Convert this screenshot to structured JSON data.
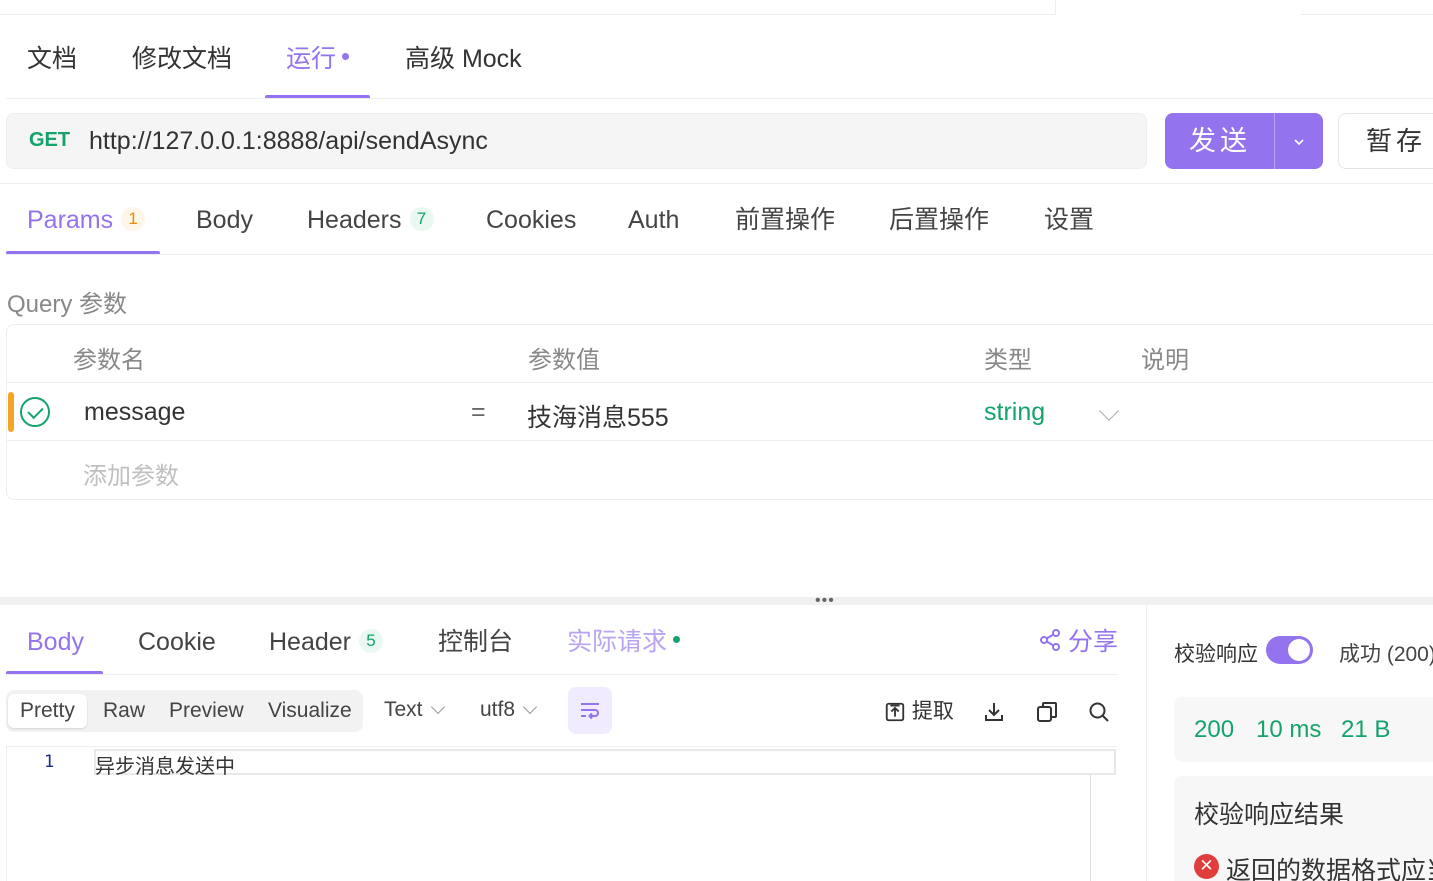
{
  "top_tabs": [
    {
      "label": "文档"
    },
    {
      "label": "修改文档"
    },
    {
      "label": "运行"
    },
    {
      "label": "高级 Mock"
    }
  ],
  "request": {
    "method": "GET",
    "url": "http://127.0.0.1:8888/api/sendAsync",
    "send_label": "发送",
    "save_label": "暂存"
  },
  "request_tabs": [
    {
      "label": "Params",
      "count": "1"
    },
    {
      "label": "Body"
    },
    {
      "label": "Headers",
      "count": "7"
    },
    {
      "label": "Cookies"
    },
    {
      "label": "Auth"
    },
    {
      "label": "前置操作"
    },
    {
      "label": "后置操作"
    },
    {
      "label": "设置"
    }
  ],
  "query": {
    "section_label": "Query 参数",
    "columns": [
      "参数名",
      "参数值",
      "类型",
      "说明"
    ],
    "rows": [
      {
        "name": "message",
        "eq": "=",
        "value": "技海消息555",
        "type": "string",
        "description": ""
      }
    ],
    "add_placeholder": "添加参数"
  },
  "response_tabs": [
    {
      "label": "Body"
    },
    {
      "label": "Cookie"
    },
    {
      "label": "Header",
      "count": "5"
    },
    {
      "label": "控制台"
    },
    {
      "label": "实际请求"
    }
  ],
  "share_label": "分享",
  "view_modes": [
    "Pretty",
    "Raw",
    "Preview",
    "Visualize"
  ],
  "format": "Text",
  "encoding": "utf8",
  "tools": {
    "extract_label": "提取"
  },
  "code": {
    "line_number": "1",
    "line_text": "异步消息发送中"
  },
  "validation": {
    "label": "校验响应",
    "status_text": "成功 (200)",
    "status_code": "200",
    "time": "10 ms",
    "size": "21 B",
    "result_title": "校验响应结果",
    "error_text": "返回的数据格式应当"
  },
  "colors": {
    "accent": "#9373ee",
    "success": "#13a36b",
    "warning": "#f5a524",
    "error": "#e23d3d"
  }
}
